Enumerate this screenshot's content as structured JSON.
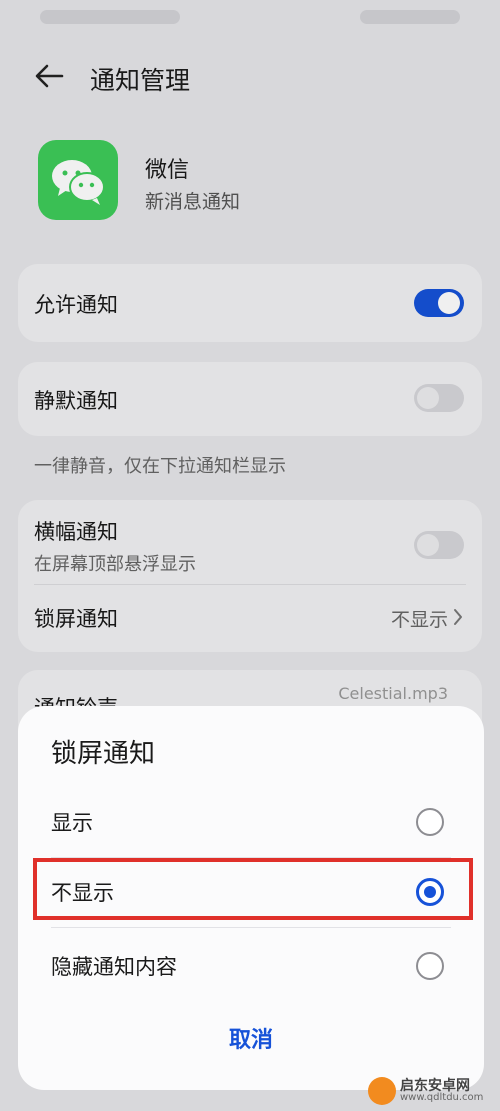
{
  "header": {
    "title": "通知管理"
  },
  "app": {
    "name": "微信",
    "subtitle": "新消息通知"
  },
  "allow": {
    "label": "允许通知",
    "enabled": true
  },
  "silent": {
    "label": "静默通知",
    "enabled": false,
    "hint": "一律静音，仅在下拉通知栏显示"
  },
  "banner": {
    "label": "横幅通知",
    "subtitle": "在屏幕顶部悬浮显示",
    "enabled": false
  },
  "lockscreen": {
    "label": "锁屏通知",
    "value": "不显示"
  },
  "ringtone": {
    "label": "通知铃声",
    "value": "Celestial.mp3"
  },
  "sheet": {
    "title": "锁屏通知",
    "options": [
      {
        "label": "显示",
        "selected": false
      },
      {
        "label": "不显示",
        "selected": true
      },
      {
        "label": "隐藏通知内容",
        "selected": false
      }
    ],
    "cancel": "取消"
  },
  "watermark": {
    "title": "启东安卓网",
    "url": "www.qdltdu.com"
  },
  "colors": {
    "accent": "#1652d8",
    "highlight": "#e0302a",
    "app_icon": "#3ecb5a"
  }
}
